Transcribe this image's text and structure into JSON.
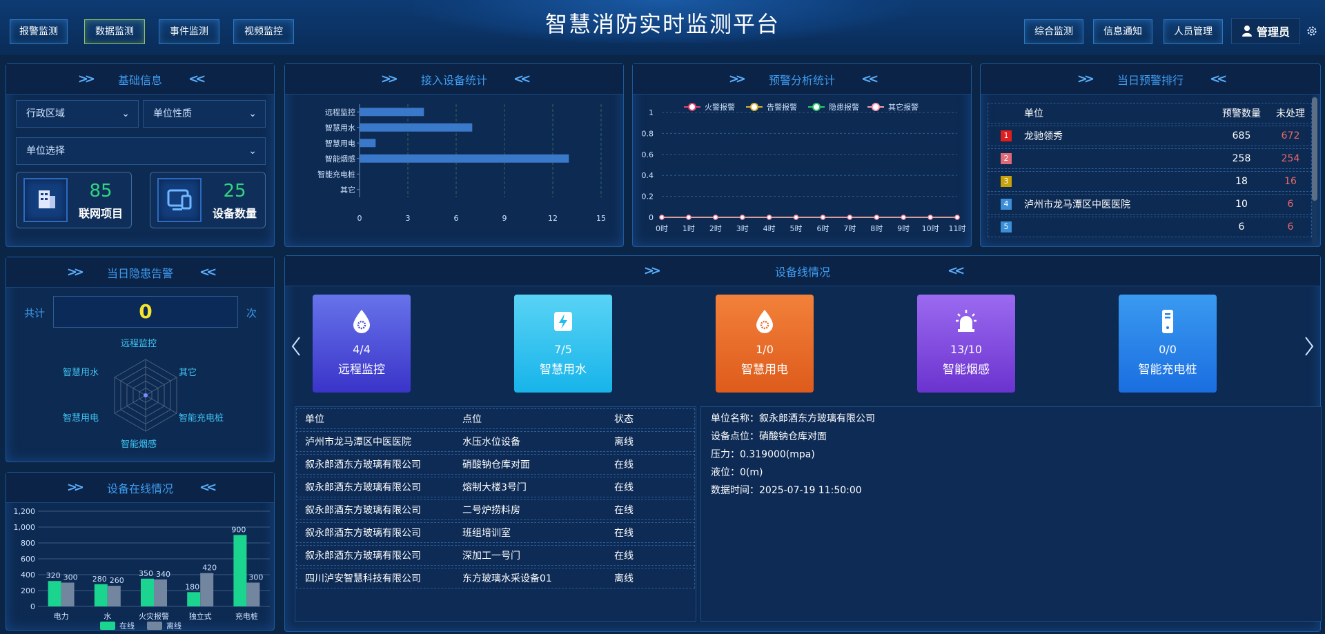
{
  "header": {
    "title": "智慧消防实时监测平台",
    "left_nav": [
      "报警监测",
      "数据监测",
      "事件监测",
      "视频监控"
    ],
    "right_nav": [
      "综合监测",
      "信息通知",
      "人员管理"
    ],
    "user": "管理员"
  },
  "basic_info": {
    "title": "基础信息",
    "select_region": "行政区域",
    "select_unit_type": "单位性质",
    "select_unit": "单位选择",
    "stats": [
      {
        "value": "85",
        "label": "联网项目"
      },
      {
        "value": "25",
        "label": "设备数量"
      }
    ]
  },
  "hazard": {
    "title": "当日隐患告警",
    "total_prefix": "共计",
    "total": "0",
    "total_suffix": "次",
    "axes": [
      "远程监控",
      "其它",
      "智能充电桩",
      "智能烟感",
      "智慧用电",
      "智慧用水"
    ]
  },
  "device_stats": {
    "title": "接入设备统计"
  },
  "warning_analysis": {
    "title": "预警分析统计"
  },
  "ranking": {
    "title": "当日预警排行",
    "headers": [
      "单位",
      "预警数量",
      "未处理"
    ],
    "rows": [
      {
        "rank": "1",
        "unit": "龙驰领秀",
        "count": "685",
        "pending": "672",
        "color": "#e01e1e"
      },
      {
        "rank": "2",
        "unit": "",
        "count": "258",
        "pending": "254",
        "color": "#e06a78"
      },
      {
        "rank": "3",
        "unit": "",
        "count": "18",
        "pending": "16",
        "color": "#c9a20a"
      },
      {
        "rank": "4",
        "unit": "泸州市龙马潭区中医医院",
        "count": "10",
        "pending": "6",
        "color": "#3b8fd8"
      },
      {
        "rank": "5",
        "unit": "",
        "count": "6",
        "pending": "6",
        "color": "#3b8fd8"
      }
    ]
  },
  "online_devices": {
    "title": "设备在线情况"
  },
  "device_lines": {
    "title": "设备线情况",
    "cards": [
      {
        "value": "4/4",
        "name": "远程监控",
        "icon": "drop-gear-icon"
      },
      {
        "value": "7/5",
        "name": "智慧用水",
        "icon": "lightning-icon"
      },
      {
        "value": "1/0",
        "name": "智慧用电",
        "icon": "drop-gear-icon"
      },
      {
        "value": "13/10",
        "name": "智能烟感",
        "icon": "alarm-light-icon"
      },
      {
        "value": "0/0",
        "name": "智能充电桩",
        "icon": "charger-icon"
      }
    ],
    "table_headers": [
      "单位",
      "点位",
      "状态"
    ],
    "table_rows": [
      {
        "unit": "泸州市龙马潭区中医医院",
        "point": "水压水位设备",
        "status": "离线"
      },
      {
        "unit": "叙永郎酒东方玻璃有限公司",
        "point": "硝酸钠仓库对面",
        "status": "在线"
      },
      {
        "unit": "叙永郎酒东方玻璃有限公司",
        "point": "熔制大楼3号门",
        "status": "在线"
      },
      {
        "unit": "叙永郎酒东方玻璃有限公司",
        "point": "二号炉捞料房",
        "status": "在线"
      },
      {
        "unit": "叙永郎酒东方玻璃有限公司",
        "point": "班组培训室",
        "status": "在线"
      },
      {
        "unit": "叙永郎酒东方玻璃有限公司",
        "point": "深加工一号门",
        "status": "在线"
      },
      {
        "unit": "四川泸安智慧科技有限公司",
        "point": "东方玻璃水采设备01",
        "status": "离线"
      }
    ],
    "detail": [
      "单位名称：叙永郎酒东方玻璃有限公司",
      "设备点位：硝酸钠仓库对面",
      "压力：0.319000(mpa)",
      "液位：0(m)",
      "数据时间：2025-07-19 11:50:00"
    ]
  },
  "chart_data": [
    {
      "type": "bar",
      "orientation": "horizontal",
      "categories": [
        "远程监控",
        "智慧用水",
        "智慧用电",
        "智能烟感",
        "智能充电桩",
        "其它"
      ],
      "values": [
        4,
        7,
        1,
        13,
        0,
        0
      ],
      "xlim": [
        0,
        15
      ],
      "xticks": [
        "0",
        "3",
        "6",
        "9",
        "12",
        "15"
      ],
      "color": "#3a78c9"
    },
    {
      "type": "line",
      "categories": [
        "0时",
        "1时",
        "2时",
        "3时",
        "4时",
        "5时",
        "6时",
        "7时",
        "8时",
        "9时",
        "10时",
        "11时"
      ],
      "series": [
        {
          "name": "火警报警",
          "values": [
            0,
            0,
            0,
            0,
            0,
            0,
            0,
            0,
            0,
            0,
            0,
            0
          ],
          "color": "#e0436b"
        },
        {
          "name": "告警报警",
          "values": [
            0,
            0,
            0,
            0,
            0,
            0,
            0,
            0,
            0,
            0,
            0,
            0
          ],
          "color": "#d9b335"
        },
        {
          "name": "隐患报警",
          "values": [
            0,
            0,
            0,
            0,
            0,
            0,
            0,
            0,
            0,
            0,
            0,
            0
          ],
          "color": "#2fc86a"
        },
        {
          "name": "其它报警",
          "values": [
            0,
            0,
            0,
            0,
            0,
            0,
            0,
            0,
            0,
            0,
            0,
            0
          ],
          "color": "#ff9bb0"
        }
      ],
      "ylim": [
        0,
        1
      ],
      "yticks": [
        "0",
        "0.2",
        "0.4",
        "0.6",
        "0.8",
        "1"
      ],
      "legend": "top"
    },
    {
      "type": "bar",
      "categories": [
        "电力",
        "水",
        "火灾报警",
        "独立式",
        "充电桩"
      ],
      "series": [
        {
          "name": "在线",
          "values": [
            320,
            280,
            350,
            180,
            900
          ],
          "color": "#1ad48f"
        },
        {
          "name": "离线",
          "values": [
            300,
            260,
            340,
            420,
            300
          ],
          "color": "#7386a0"
        }
      ],
      "ylim": [
        0,
        1200
      ],
      "yticks": [
        "0",
        "200",
        "400",
        "600",
        "800",
        "1,000",
        "1,200"
      ],
      "legend": "bottom"
    },
    {
      "type": "radar",
      "axes": [
        "远程监控",
        "其它",
        "智能充电桩",
        "智能烟感",
        "智慧用电",
        "智慧用水"
      ],
      "values": [
        0,
        0,
        0,
        0,
        0,
        0
      ]
    }
  ]
}
